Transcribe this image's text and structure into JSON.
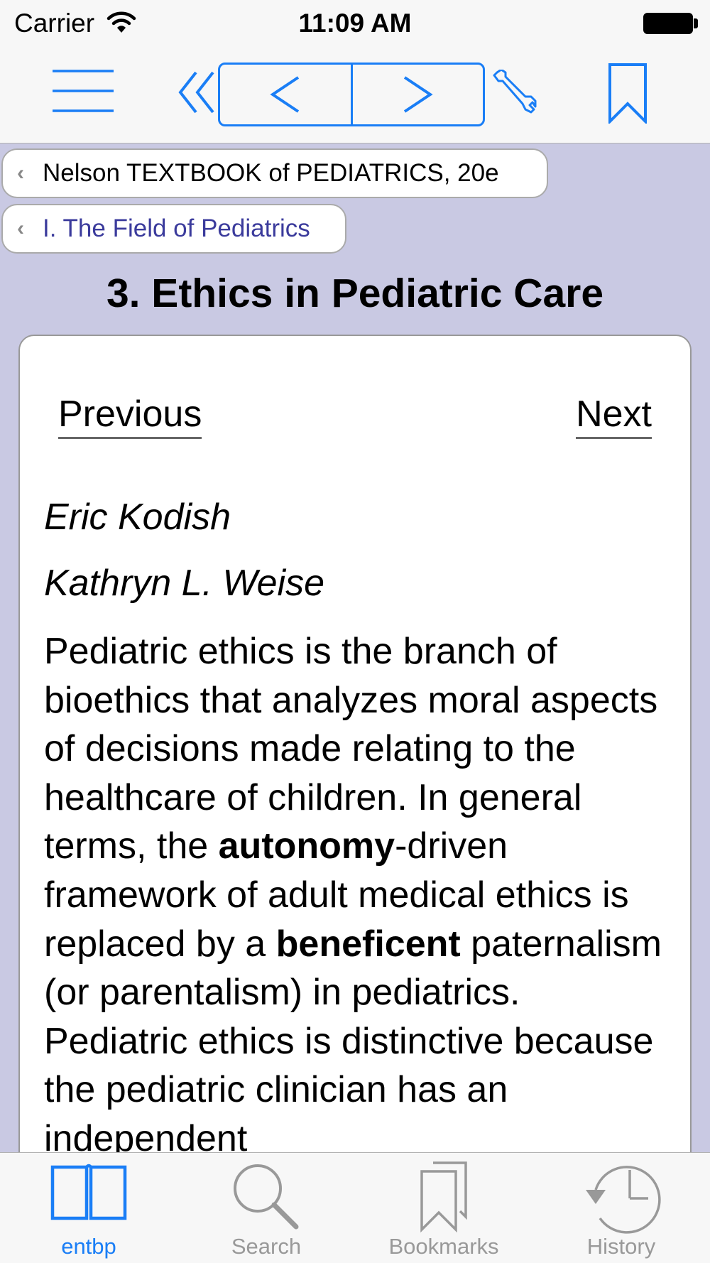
{
  "status": {
    "carrier": "Carrier",
    "time": "11:09 AM"
  },
  "breadcrumbs": [
    {
      "label": "Nelson TEXTBOOK of PEDIATRICS, 20e"
    },
    {
      "label": "I. The Field of Pediatrics"
    }
  ],
  "chapter": {
    "title": "3. Ethics in Pediatric Care"
  },
  "content": {
    "previous": "Previous",
    "next": "Next",
    "authors": [
      "Eric Kodish",
      "Kathryn L. Weise"
    ],
    "body_parts": [
      "Pediatric ethics is the branch of bioethics that analyzes moral aspects of decisions made relating to the healthcare of children. In general terms, the ",
      "autonomy",
      "-driven framework of adult medical ethics is replaced by a ",
      "beneficent",
      " paternalism (or parentalism) in pediatrics. Pediatric ethics is distinctive because the pediatric clinician has an independent"
    ]
  },
  "tabs": [
    {
      "label": "entbp",
      "icon": "book-icon",
      "active": true
    },
    {
      "label": "Search",
      "icon": "search-icon",
      "active": false
    },
    {
      "label": "Bookmarks",
      "icon": "bookmarks-icon",
      "active": false
    },
    {
      "label": "History",
      "icon": "history-icon",
      "active": false
    }
  ],
  "colors": {
    "accent": "#1a7ef6",
    "background": "#c9c9e3",
    "inactive": "#999999"
  }
}
